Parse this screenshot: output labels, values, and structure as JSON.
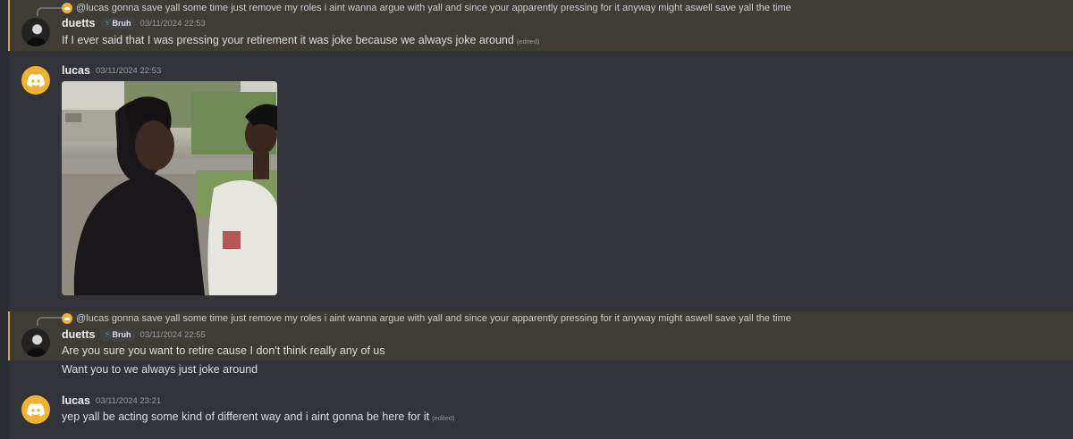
{
  "reply_preview": {
    "text": "@lucas gonna save yall some time just remove my roles i aint wanna argue with yall and since your apparently pressing for it anyway might aswell save yall the time"
  },
  "messages": [
    {
      "author": "duetts",
      "tag": "Bruh",
      "timestamp": "03/11/2024 22:53",
      "text": "If I ever said that I was pressing your retirement it was joke because we always joke around",
      "edited": "(edited)"
    },
    {
      "author": "lucas",
      "timestamp": "03/11/2024 22:53"
    },
    {
      "author": "duetts",
      "tag": "Bruh",
      "timestamp": "03/11/2024 22:55",
      "text": "Are you sure you want to retire cause I don't think really any of us",
      "followup": "Want you to we always just joke around"
    },
    {
      "author": "lucas",
      "timestamp": "03/11/2024 23:21",
      "text": "yep yall be acting some kind of different way and i aint gonna be here for it",
      "edited": "(edited)"
    }
  ],
  "colors": {
    "background": "#313338",
    "highlight": "#3f3c36",
    "highlight_bar": "#d4a446",
    "lucas_avatar": "#f0b232",
    "tag_bolt": "#3ba55c"
  }
}
